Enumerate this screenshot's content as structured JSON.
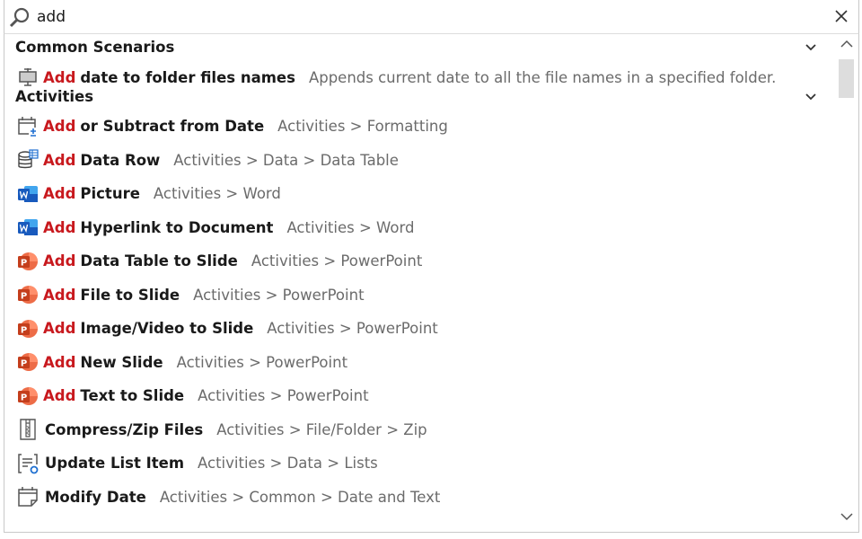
{
  "search": {
    "value": "add",
    "icon": "search-icon",
    "clear_icon": "close-icon"
  },
  "highlight_color": "#c8191e",
  "sections": [
    {
      "title": "Common Scenarios",
      "items": [
        {
          "icon": "monitor-icon",
          "match": "Add",
          "title": "date to folder files names",
          "desc": "Appends current date to all the file names in a specified folder."
        }
      ]
    },
    {
      "title": "Activities",
      "items": [
        {
          "icon": "calendar-add-icon",
          "match": "Add",
          "title": "or Subtract from Date",
          "desc": "Activities > Formatting"
        },
        {
          "icon": "database-table-icon",
          "match": "Add",
          "title": "Data Row",
          "desc": "Activities > Data > Data Table"
        },
        {
          "icon": "word-icon",
          "match": "Add",
          "title": "Picture",
          "desc": "Activities > Word"
        },
        {
          "icon": "word-icon",
          "match": "Add",
          "title": "Hyperlink to Document",
          "desc": "Activities > Word"
        },
        {
          "icon": "powerpoint-icon",
          "match": "Add",
          "title": "Data Table to Slide",
          "desc": "Activities > PowerPoint"
        },
        {
          "icon": "powerpoint-icon",
          "match": "Add",
          "title": "File to Slide",
          "desc": "Activities > PowerPoint"
        },
        {
          "icon": "powerpoint-icon",
          "match": "Add",
          "title": "Image/Video to Slide",
          "desc": "Activities > PowerPoint"
        },
        {
          "icon": "powerpoint-icon",
          "match": "Add",
          "title": "New Slide",
          "desc": "Activities > PowerPoint"
        },
        {
          "icon": "powerpoint-icon",
          "match": "Add",
          "title": "Text to Slide",
          "desc": "Activities > PowerPoint"
        },
        {
          "icon": "zip-icon",
          "match": "",
          "title": "Compress/Zip Files",
          "desc": "Activities > File/Folder > Zip"
        },
        {
          "icon": "list-update-icon",
          "match": "",
          "title": "Update List Item",
          "desc": "Activities > Data > Lists"
        },
        {
          "icon": "calendar-icon",
          "match": "",
          "title": "Modify Date",
          "desc": "Activities > Common > Date and Text"
        }
      ]
    }
  ]
}
